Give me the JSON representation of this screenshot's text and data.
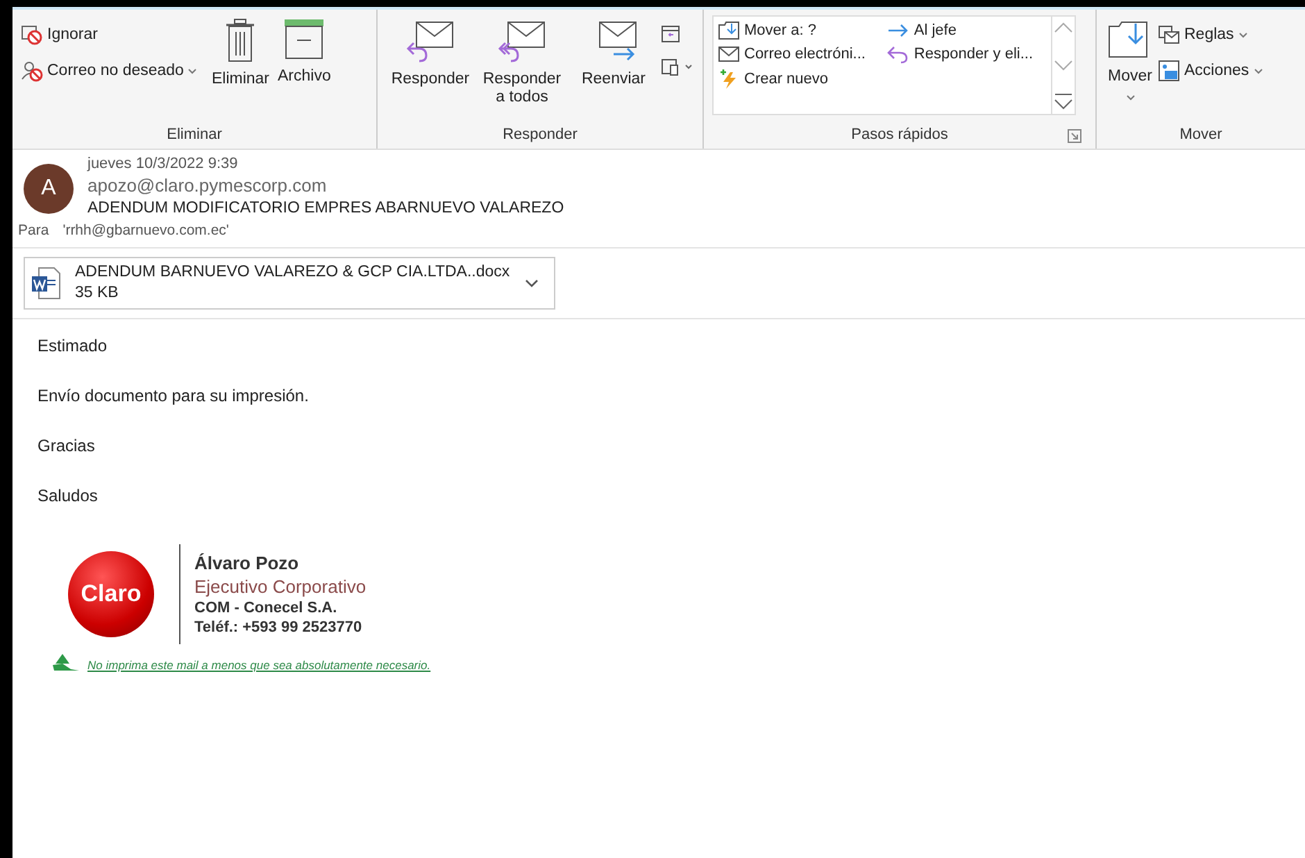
{
  "ribbon": {
    "groups": [
      {
        "kind": "actions",
        "label": "Eliminar",
        "small": [
          {
            "label": "Ignorar",
            "dropdown": false
          },
          {
            "label": "Correo no deseado",
            "dropdown": true
          }
        ],
        "large": [
          {
            "label": "Eliminar",
            "dropdown": false
          },
          {
            "label": "Archivo",
            "dropdown": false
          }
        ]
      },
      {
        "kind": "respond",
        "label": "Responder",
        "large": [
          {
            "label": "Responder"
          },
          {
            "label": "Responder a todos"
          },
          {
            "label": "Reenviar"
          }
        ]
      },
      {
        "kind": "quicksteps",
        "label": "Pasos rápidos",
        "steps": [
          {
            "label": "Mover a: ?"
          },
          {
            "label": "Al jefe"
          },
          {
            "label": "Correo electróni..."
          },
          {
            "label": "Responder y eli..."
          },
          {
            "label": "Crear nuevo"
          }
        ]
      },
      {
        "kind": "move",
        "label": "Mover",
        "large": [
          {
            "label": "Mover",
            "dropdown": true
          }
        ],
        "small": [
          {
            "label": "Reglas",
            "dropdown": true
          },
          {
            "label": "Acciones",
            "dropdown": true
          }
        ]
      }
    ]
  },
  "message": {
    "avatar": "A",
    "date": "jueves 10/3/2022 9:39",
    "sender": "apozo@claro.pymescorp.com",
    "subject": "ADENDUM MODIFICATORIO EMPRES ABARNUEVO VALAREZO",
    "to_label": "Para",
    "to": "'rrhh@gbarnuevo.com.ec'",
    "attachment": {
      "name": "ADENDUM BARNUEVO VALAREZO & GCP CIA.LTDA..docx",
      "size": "35 KB"
    },
    "body": [
      "Estimado",
      "Envío documento para su impresión.",
      "Gracias",
      "Saludos"
    ],
    "signature": {
      "logo": "Claro",
      "name": "Álvaro Pozo",
      "title": "Ejecutivo Corporativo",
      "company": "COM - Conecel S.A.",
      "phone": "Teléf.: +593 99 2523770",
      "notice": "No imprima este mail a menos que sea absolutamente necesario."
    }
  }
}
